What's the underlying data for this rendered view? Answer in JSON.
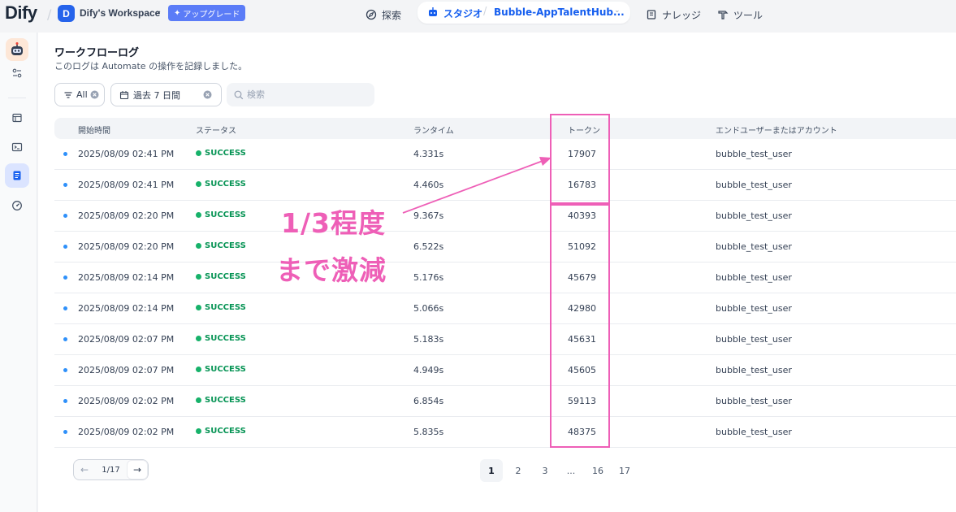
{
  "header": {
    "logo": "Dify",
    "workspace_initial": "D",
    "workspace_name": "Dify's Workspace",
    "upgrade_label": "アップグレード",
    "nav": {
      "explore": "探索",
      "studio": "スタジオ",
      "app_name": "Bubble-AppTalentHub...",
      "knowledge": "ナレッジ",
      "tools": "ツール"
    }
  },
  "page": {
    "title": "ワークフローログ",
    "subtitle": "このログは Automate の操作を記録しました。"
  },
  "filters": {
    "status": "All",
    "period": "過去 7 日間",
    "search_placeholder": "検索"
  },
  "table": {
    "headers": {
      "start_time": "開始時間",
      "status": "ステータス",
      "runtime": "ランタイム",
      "tokens": "トークン",
      "user": "エンドユーザーまたはアカウント"
    },
    "rows": [
      {
        "time": "2025/08/09 02:41 PM",
        "status": "SUCCESS",
        "runtime": "4.331s",
        "tokens": "17907",
        "user": "bubble_test_user"
      },
      {
        "time": "2025/08/09 02:41 PM",
        "status": "SUCCESS",
        "runtime": "4.460s",
        "tokens": "16783",
        "user": "bubble_test_user"
      },
      {
        "time": "2025/08/09 02:20 PM",
        "status": "SUCCESS",
        "runtime": "9.367s",
        "tokens": "40393",
        "user": "bubble_test_user"
      },
      {
        "time": "2025/08/09 02:20 PM",
        "status": "SUCCESS",
        "runtime": "6.522s",
        "tokens": "51092",
        "user": "bubble_test_user"
      },
      {
        "time": "2025/08/09 02:14 PM",
        "status": "SUCCESS",
        "runtime": "5.176s",
        "tokens": "45679",
        "user": "bubble_test_user"
      },
      {
        "time": "2025/08/09 02:14 PM",
        "status": "SUCCESS",
        "runtime": "5.066s",
        "tokens": "42980",
        "user": "bubble_test_user"
      },
      {
        "time": "2025/08/09 02:07 PM",
        "status": "SUCCESS",
        "runtime": "5.183s",
        "tokens": "45631",
        "user": "bubble_test_user"
      },
      {
        "time": "2025/08/09 02:07 PM",
        "status": "SUCCESS",
        "runtime": "4.949s",
        "tokens": "45605",
        "user": "bubble_test_user"
      },
      {
        "time": "2025/08/09 02:02 PM",
        "status": "SUCCESS",
        "runtime": "6.854s",
        "tokens": "59113",
        "user": "bubble_test_user"
      },
      {
        "time": "2025/08/09 02:02 PM",
        "status": "SUCCESS",
        "runtime": "5.835s",
        "tokens": "48375",
        "user": "bubble_test_user"
      }
    ]
  },
  "pagination": {
    "count_label": "1/17",
    "pages": [
      "1",
      "2",
      "3",
      "...",
      "16",
      "17"
    ],
    "current": "1"
  },
  "annotation": {
    "line1": "1/3程度",
    "line2": "まで激減",
    "color": "#ee5fb7"
  },
  "colors": {
    "accent": "#155eef",
    "success": "#17b26a",
    "annotation": "#ee5fb7"
  }
}
